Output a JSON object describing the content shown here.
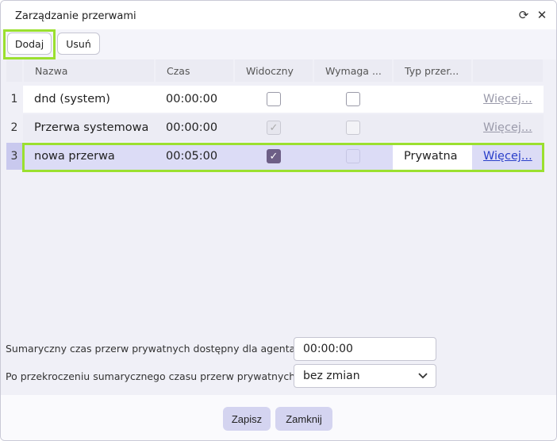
{
  "window": {
    "title": "Zarządzanie przerwami",
    "refresh_icon": "refresh-icon",
    "close_icon": "close-icon"
  },
  "toolbar": {
    "add_label": "Dodaj",
    "remove_label": "Usuń"
  },
  "table": {
    "columns": [
      "Nazwa",
      "Czas",
      "Widoczny",
      "Wymaga ...",
      "Typ przer..."
    ],
    "rows": [
      {
        "num": "1",
        "name": "dnd (system)",
        "time": "00:00:00",
        "visible": false,
        "requires": false,
        "type": "",
        "more": "Więcej..."
      },
      {
        "num": "2",
        "name": "Przerwa systemowa",
        "time": "00:00:00",
        "visible": true,
        "requires": false,
        "type": "",
        "more": "Więcej..."
      },
      {
        "num": "3",
        "name": "nowa przerwa",
        "time": "00:05:00",
        "visible": true,
        "requires": false,
        "type": "Prywatna",
        "more": "Więcej..."
      }
    ]
  },
  "settings": {
    "total_time_label": "Sumaryczny czas przerw prywatnych dostępny dla agenta",
    "total_time_value": "00:00:00",
    "exceed_label": "Po przekroczeniu sumarycznego czasu przerw prywatnych",
    "exceed_value": "bez zmian"
  },
  "footer": {
    "save_label": "Zapisz",
    "close_label": "Zamknij"
  },
  "colors": {
    "highlight": "#9be02f",
    "selected_row": "#dcdcf6",
    "link_active": "#2a3fc9",
    "link_disabled": "#9a9aaa"
  }
}
